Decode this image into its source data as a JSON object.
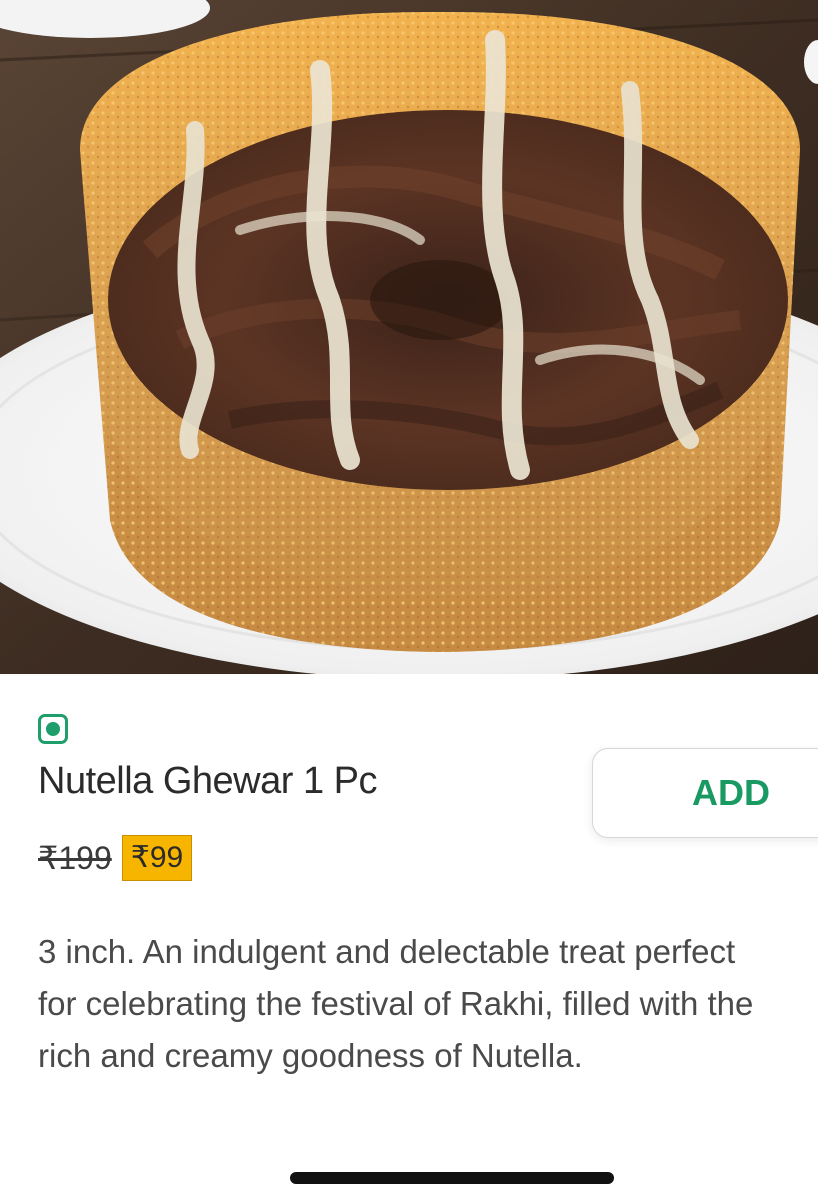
{
  "item": {
    "name": "Nutella Ghewar 1 Pc",
    "veg_indicator_icon": "veg-dot-icon",
    "original_price": "₹199",
    "discounted_price": "₹99",
    "description": "3 inch. An indulgent and delectable treat perfect for celebrating the festival of Rakhi, filled with the rich and creamy goodness of Nutella."
  },
  "actions": {
    "add_label": "ADD"
  },
  "colors": {
    "veg_green": "#1e9e6a",
    "add_green": "#1a9a63",
    "price_badge": "#f7b500"
  }
}
